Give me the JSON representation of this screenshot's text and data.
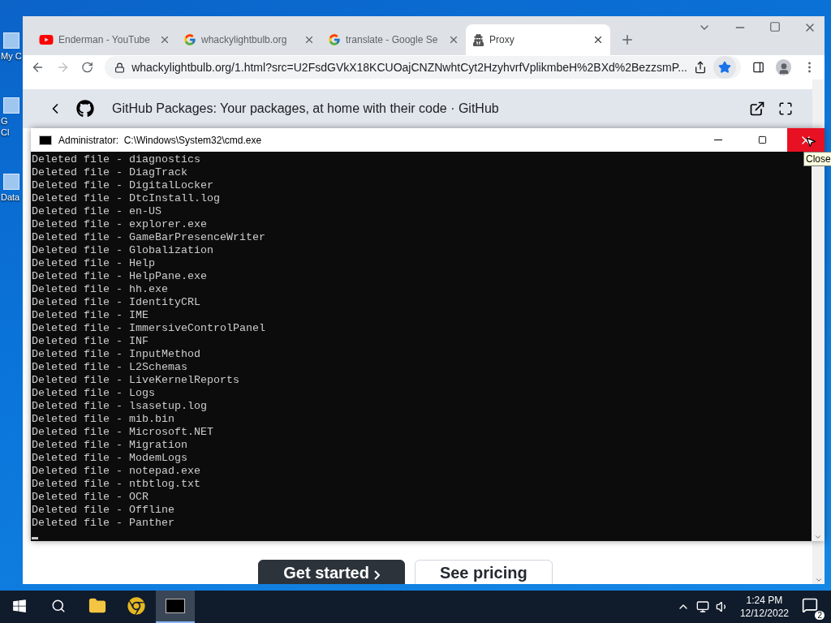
{
  "desktop_icons": [
    {
      "lines": [
        "My C"
      ]
    },
    {
      "lines": [
        "G",
        "Cl"
      ]
    },
    {
      "lines": [
        "Data"
      ]
    }
  ],
  "browser": {
    "tabs": [
      {
        "kind": "youtube",
        "label": "Enderman - YouTube",
        "selected": false
      },
      {
        "kind": "google",
        "label": "whackylightbulb.org",
        "selected": false
      },
      {
        "kind": "google",
        "label": "translate - Google Se",
        "selected": false
      },
      {
        "kind": "proxy",
        "label": "Proxy",
        "selected": true
      }
    ],
    "address": "whackylightbulb.org/1.html?src=U2FsdGVkX18KCUOajCNZNwhtCyt2HzyhvrfVplikmbeH%2BXd%2BezzsmP...",
    "bookmarked": true,
    "page": {
      "header_title": "GitHub Packages: Your packages, at home with their code · GitHub",
      "buttons": [
        {
          "kind": "primary",
          "label": "Get started"
        },
        {
          "kind": "secondary",
          "label": "See pricing"
        }
      ]
    }
  },
  "console": {
    "title": "Administrator:  C:\\Windows\\System32\\cmd.exe",
    "tooltip": "Close",
    "lines": [
      "Deleted file - diagnostics",
      "Deleted file - DiagTrack",
      "Deleted file - DigitalLocker",
      "Deleted file - DtcInstall.log",
      "Deleted file - en-US",
      "Deleted file - explorer.exe",
      "Deleted file - GameBarPresenceWriter",
      "Deleted file - Globalization",
      "Deleted file - Help",
      "Deleted file - HelpPane.exe",
      "Deleted file - hh.exe",
      "Deleted file - IdentityCRL",
      "Deleted file - IME",
      "Deleted file - ImmersiveControlPanel",
      "Deleted file - INF",
      "Deleted file - InputMethod",
      "Deleted file - L2Schemas",
      "Deleted file - LiveKernelReports",
      "Deleted file - Logs",
      "Deleted file - lsasetup.log",
      "Deleted file - mib.bin",
      "Deleted file - Microsoft.NET",
      "Deleted file - Migration",
      "Deleted file - ModemLogs",
      "Deleted file - notepad.exe",
      "Deleted file - ntbtlog.txt",
      "Deleted file - OCR",
      "Deleted file - Offline",
      "Deleted file - Panther"
    ]
  },
  "taskbar": {
    "apps": [
      {
        "kind": "explorer",
        "selected": false
      },
      {
        "kind": "chrome",
        "selected": false
      },
      {
        "kind": "console",
        "selected": true
      }
    ],
    "time": "1:24 PM",
    "date": "12/12/2022",
    "notifications": "2"
  }
}
